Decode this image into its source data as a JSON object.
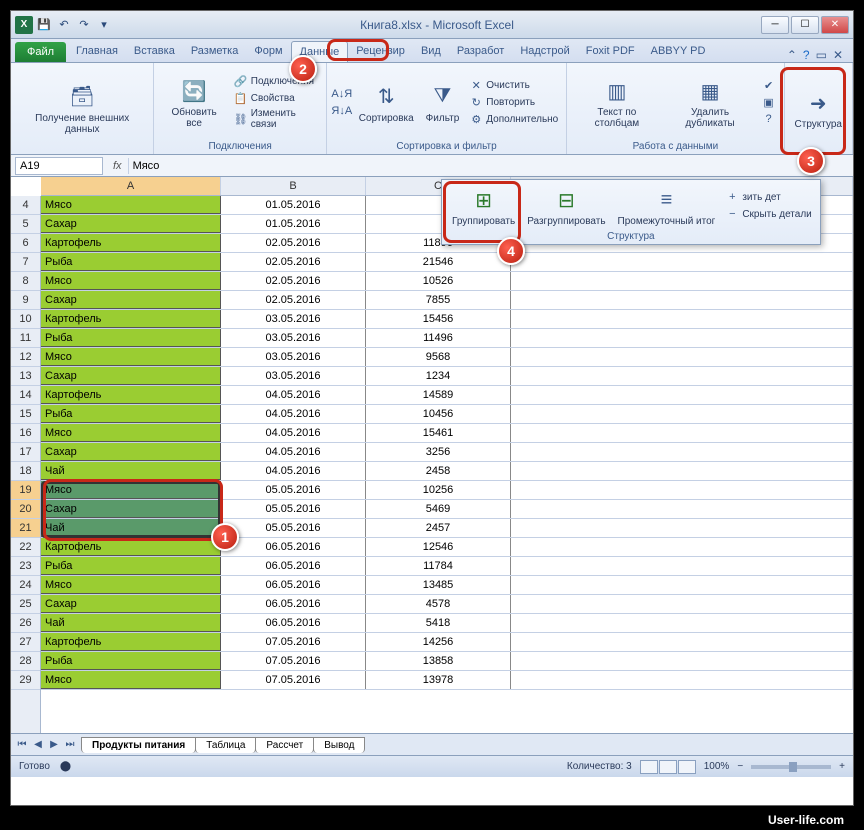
{
  "title": "Книга8.xlsx - Microsoft Excel",
  "qat": {
    "save": "💾",
    "undo": "↶",
    "redo": "↷"
  },
  "tabs": {
    "file": "Файл",
    "items": [
      "Главная",
      "Вставка",
      "Разметка",
      "Форм",
      "Данные",
      "Рецензир",
      "Вид",
      "Разработ",
      "Надстрой",
      "Foxit PDF",
      "ABBYY PD"
    ],
    "active_index": 4
  },
  "ribbon": {
    "g1": {
      "btn1": "Получение\nвнешних данных",
      "label": ""
    },
    "g2": {
      "btn1": "Обновить\nвсе",
      "s1": "Подключения",
      "s2": "Свойства",
      "s3": "Изменить связи",
      "label": "Подключения"
    },
    "g3": {
      "btn1": "Сортировка",
      "btn2": "Фильтр",
      "s1": "Очистить",
      "s2": "Повторить",
      "s3": "Дополнительно",
      "label": "Сортировка и фильтр",
      "az": "А↓Я",
      "za": "Я↓А"
    },
    "g4": {
      "btn1": "Текст по\nстолбцам",
      "btn2": "Удалить\nдубликаты",
      "label": "Работа с данными"
    },
    "g5": {
      "btn1": "Структура"
    },
    "popup": {
      "b1": "Группировать",
      "b2": "Разгруппировать",
      "b3": "Промежуточный\nитог",
      "s1": "зить дет",
      "s2": "Скрыть детали",
      "label": "Структура"
    }
  },
  "namebox": "A19",
  "formula": "Мясо",
  "columns": [
    "A",
    "B",
    "C"
  ],
  "first_row": 4,
  "selected_rows": [
    19,
    20,
    21
  ],
  "rows": [
    {
      "a": "Мясо",
      "b": "01.05.2016",
      "c": ""
    },
    {
      "a": "Сахар",
      "b": "01.05.2016",
      "c": ""
    },
    {
      "a": "Картофель",
      "b": "02.05.2016",
      "c": "11896"
    },
    {
      "a": "Рыба",
      "b": "02.05.2016",
      "c": "21546"
    },
    {
      "a": "Мясо",
      "b": "02.05.2016",
      "c": "10526"
    },
    {
      "a": "Сахар",
      "b": "02.05.2016",
      "c": "7855"
    },
    {
      "a": "Картофель",
      "b": "03.05.2016",
      "c": "15456"
    },
    {
      "a": "Рыба",
      "b": "03.05.2016",
      "c": "11496"
    },
    {
      "a": "Мясо",
      "b": "03.05.2016",
      "c": "9568"
    },
    {
      "a": "Сахар",
      "b": "03.05.2016",
      "c": "1234"
    },
    {
      "a": "Картофель",
      "b": "04.05.2016",
      "c": "14589"
    },
    {
      "a": "Рыба",
      "b": "04.05.2016",
      "c": "10456"
    },
    {
      "a": "Мясо",
      "b": "04.05.2016",
      "c": "15461"
    },
    {
      "a": "Сахар",
      "b": "04.05.2016",
      "c": "3256"
    },
    {
      "a": "Чай",
      "b": "04.05.2016",
      "c": "2458"
    },
    {
      "a": "Мясо",
      "b": "05.05.2016",
      "c": "10256"
    },
    {
      "a": "Сахар",
      "b": "05.05.2016",
      "c": "5469"
    },
    {
      "a": "Чай",
      "b": "05.05.2016",
      "c": "2457"
    },
    {
      "a": "Картофель",
      "b": "06.05.2016",
      "c": "12546"
    },
    {
      "a": "Рыба",
      "b": "06.05.2016",
      "c": "11784"
    },
    {
      "a": "Мясо",
      "b": "06.05.2016",
      "c": "13485"
    },
    {
      "a": "Сахар",
      "b": "06.05.2016",
      "c": "4578"
    },
    {
      "a": "Чай",
      "b": "06.05.2016",
      "c": "5418"
    },
    {
      "a": "Картофель",
      "b": "07.05.2016",
      "c": "14256"
    },
    {
      "a": "Рыба",
      "b": "07.05.2016",
      "c": "13858"
    },
    {
      "a": "Мясо",
      "b": "07.05.2016",
      "c": "13978"
    }
  ],
  "sheets": [
    "Продукты питания",
    "Таблица",
    "Рассчет",
    "Вывод"
  ],
  "status": {
    "ready": "Готово",
    "count": "Количество: 3",
    "zoom": "100%"
  },
  "markers": {
    "m1": "1",
    "m2": "2",
    "m3": "3",
    "m4": "4"
  },
  "watermark": "User-life.com"
}
